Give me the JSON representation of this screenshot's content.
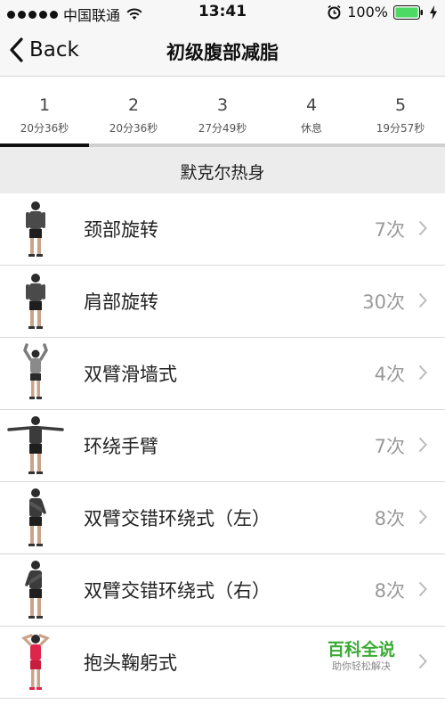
{
  "status_bar": {
    "carrier": "中国联通",
    "time": "13:41",
    "battery": "100%"
  },
  "nav": {
    "back_label": "Back",
    "title": "初级腹部减脂"
  },
  "tabs": [
    {
      "number": "1",
      "subtitle": "20分36秒",
      "active": true
    },
    {
      "number": "2",
      "subtitle": "20分36秒",
      "active": false
    },
    {
      "number": "3",
      "subtitle": "27分49秒",
      "active": false
    },
    {
      "number": "4",
      "subtitle": "休息",
      "active": false
    },
    {
      "number": "5",
      "subtitle": "19分57秒",
      "active": false
    }
  ],
  "section": {
    "title": "默克尔热身"
  },
  "exercises": [
    {
      "name": "颈部旋转",
      "count": "7次"
    },
    {
      "name": "肩部旋转",
      "count": "30次"
    },
    {
      "name": "双臂滑墙式",
      "count": "4次"
    },
    {
      "name": "环绕手臂",
      "count": "7次"
    },
    {
      "name": "双臂交错环绕式（左）",
      "count": "8次"
    },
    {
      "name": "双臂交错环绕式（右）",
      "count": "8次"
    },
    {
      "name": "抱头鞠躬式",
      "count": ""
    }
  ],
  "watermark": {
    "title": "百科全说",
    "subtitle": "助你轻松解决"
  },
  "colors": {
    "bar_bg": "#f7f7f7",
    "section_bg": "#ececec",
    "count_text": "#999999",
    "watermark_green": "#3aaa35",
    "battery_green": "#4cd964"
  },
  "icons": {
    "back": "chevron-left-icon",
    "row": "chevron-right-icon",
    "status": [
      "signal-icon",
      "wifi-icon",
      "alarm-icon",
      "battery-icon",
      "charging-bolt-icon"
    ]
  }
}
